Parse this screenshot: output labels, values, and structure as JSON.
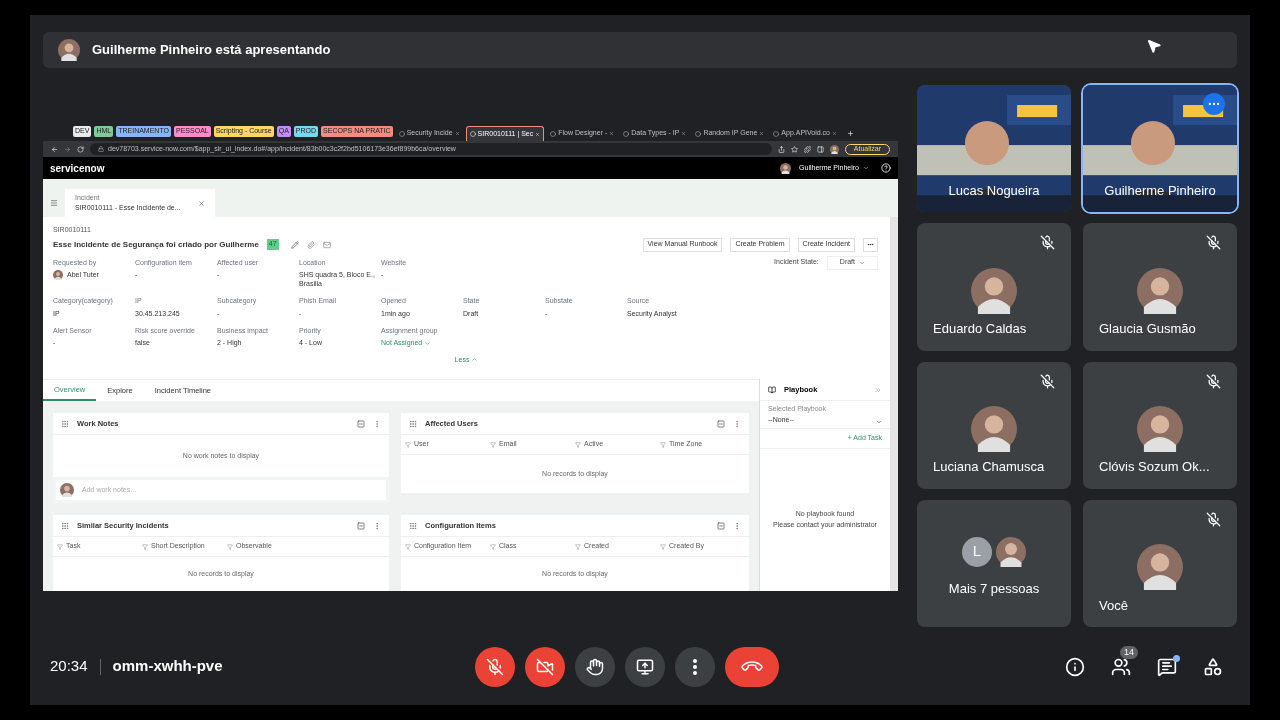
{
  "presenter_banner": {
    "text": "Guilherme Pinheiro está apresentando"
  },
  "shared_screen": {
    "tab_groups": [
      {
        "label": "DEV",
        "color": "#e8eaed"
      },
      {
        "label": "HML",
        "color": "#81c995"
      },
      {
        "label": "TREINAMENTO",
        "color": "#8ab4f8"
      },
      {
        "label": "PESSOAL",
        "color": "#ff8bcb"
      },
      {
        "label": "Scripting - Course",
        "color": "#fdd663"
      },
      {
        "label": "QA",
        "color": "#c58af9"
      },
      {
        "label": "PROD",
        "color": "#78d9ec"
      },
      {
        "label": "SECOPS NA PRATIC",
        "color": "#f28b82"
      }
    ],
    "tabs": [
      {
        "label": "Security Incide",
        "selected": false
      },
      {
        "label": "SIR0010111 | Sec",
        "selected": true
      },
      {
        "label": "Flow Designer -",
        "selected": false
      },
      {
        "label": "Data Types - IP",
        "selected": false
      },
      {
        "label": "Random IP Gene",
        "selected": false
      },
      {
        "label": "App.APIVoid.co",
        "selected": false
      }
    ],
    "url": "dev78703.service-now.com/$app_sir_ui_index.do#/app/incident/83b00c3c2f2bd5106173e36ef899b6ca/overview",
    "update_button": "Atualizar",
    "app_logo": "servicenow",
    "user_menu": "Guilherme Pinheiro",
    "record_tab": {
      "caption": "Incident",
      "title": "SIR0010111 - Esse Incidente de..."
    },
    "record": {
      "number": "SIR0010111",
      "title": "Esse Incidente de Segurança foi criado por Guilherme",
      "score": "47",
      "actions": [
        "View Manual Runbook",
        "Create Problem",
        "Create Incident"
      ],
      "state_label": "Incident State:",
      "state_value": "Draft"
    },
    "field_rows": [
      [
        {
          "label": "Requested by",
          "value": "Abel Tuter",
          "kind": "user"
        },
        {
          "label": "Configuration item",
          "value": "-",
          "kind": "text"
        },
        {
          "label": "Affected user",
          "value": "-",
          "kind": "text"
        },
        {
          "label": "Location",
          "value": "SHS quadra 5, Bloco E., Brasilia",
          "kind": "text"
        },
        {
          "label": "Website",
          "value": "-",
          "kind": "text"
        }
      ],
      [
        {
          "label": "Category(category)",
          "value": "IP",
          "kind": "text"
        },
        {
          "label": "IP",
          "value": "30.45.213.245",
          "kind": "text"
        },
        {
          "label": "Subcategory",
          "value": "-",
          "kind": "text"
        },
        {
          "label": "Phish Email",
          "value": "-",
          "kind": "text"
        },
        {
          "label": "Opened",
          "value": "1min ago",
          "kind": "text"
        },
        {
          "label": "State",
          "value": "Draft",
          "kind": "text"
        },
        {
          "label": "Substate",
          "value": "-",
          "kind": "text"
        },
        {
          "label": "Source",
          "value": "Security Analyst",
          "kind": "text"
        }
      ],
      [
        {
          "label": "Alert Sensor",
          "value": "-",
          "kind": "text"
        },
        {
          "label": "Risk score override",
          "value": "false",
          "kind": "text"
        },
        {
          "label": "Business impact",
          "value": "2 - High",
          "kind": "text"
        },
        {
          "label": "Priority",
          "value": "4 - Low",
          "kind": "text"
        },
        {
          "label": "Assignment group",
          "value": "Not Assigned",
          "kind": "link"
        }
      ]
    ],
    "less_link": "Less",
    "view_tabs": [
      {
        "label": "Overview",
        "selected": true
      },
      {
        "label": "Explore",
        "selected": false
      },
      {
        "label": "Incident Timeline",
        "selected": false
      }
    ],
    "cards_left": [
      {
        "title": "Work Notes",
        "kind": "notes",
        "empty": "No work notes to display",
        "placeholder": "Add work notes..."
      },
      {
        "title": "Similar Security Incidents",
        "kind": "table",
        "columns": [
          "Task",
          "Short Description",
          "Observable"
        ],
        "empty": "No records to display"
      }
    ],
    "cards_right": [
      {
        "title": "Affected Users",
        "kind": "table",
        "columns": [
          "User",
          "Email",
          "Active",
          "Time Zone"
        ],
        "empty": "No records to display"
      },
      {
        "title": "Configuration Items",
        "kind": "table",
        "columns": [
          "Configuration Item",
          "Class",
          "Created",
          "Created By"
        ],
        "empty": "No records to display"
      }
    ],
    "playbook": {
      "title": "Playbook",
      "select_label": "Selected Playbook",
      "select_value": "--None--",
      "add_task": "+ Add Task",
      "empty_lines": [
        "No playbook found",
        "Please contact your administrator"
      ]
    }
  },
  "participants": [
    {
      "name": "Lucas Nogueira",
      "kind": "video",
      "muted": false,
      "speaking": false
    },
    {
      "name": "Guilherme Pinheiro",
      "kind": "video",
      "muted": false,
      "speaking": true
    },
    {
      "name": "Eduardo Caldas",
      "kind": "avatar",
      "muted": true,
      "speaking": false
    },
    {
      "name": "Glaucia Gusmão",
      "kind": "avatar",
      "muted": true,
      "speaking": false
    },
    {
      "name": "Luciana Chamusca",
      "kind": "avatar",
      "muted": true,
      "speaking": false
    },
    {
      "name": "Clóvis Sozum Ok...",
      "kind": "avatar",
      "muted": true,
      "speaking": false
    },
    {
      "name": "Mais 7 pessoas",
      "kind": "group",
      "initial": "L",
      "muted": false,
      "speaking": false
    },
    {
      "name": "Você",
      "kind": "avatar",
      "muted": true,
      "speaking": false
    }
  ],
  "meeting": {
    "time": "20:34",
    "code": "omm-xwhh-pve",
    "people_count": "14",
    "chat_unread": true
  }
}
